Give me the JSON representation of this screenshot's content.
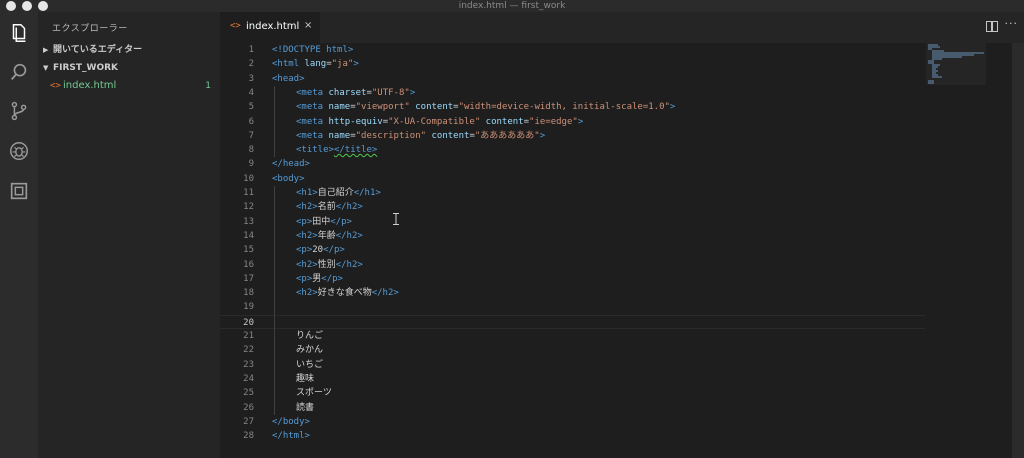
{
  "window": {
    "title": "index.html — first_work"
  },
  "activity_bar": {
    "icons": [
      "files-icon",
      "search-icon",
      "source-control-icon",
      "debug-icon",
      "extensions-icon"
    ]
  },
  "sidebar": {
    "title": "エクスプローラー",
    "open_editors_label": "開いているエディター",
    "project_label": "FIRST_WORK",
    "file": {
      "icon": "<>",
      "name": "index.html",
      "badge": "1"
    }
  },
  "tab": {
    "icon": "<>",
    "label": "index.html",
    "close": "×"
  },
  "editor": {
    "line_numbers": [
      "1",
      "2",
      "3",
      "4",
      "5",
      "6",
      "7",
      "8",
      "9",
      "10",
      "11",
      "12",
      "13",
      "14",
      "15",
      "16",
      "17",
      "18",
      "19",
      "20",
      "21",
      "22",
      "23",
      "24",
      "25",
      "26",
      "27",
      "28"
    ],
    "lines": [
      {
        "indent": 0,
        "parts": [
          {
            "t": "tag",
            "v": "<!DOCTYPE html>"
          }
        ]
      },
      {
        "indent": 0,
        "parts": [
          {
            "t": "tag",
            "v": "<html "
          },
          {
            "t": "attr",
            "v": "lang"
          },
          {
            "t": "txt",
            "v": "="
          },
          {
            "t": "str",
            "v": "\"ja\""
          },
          {
            "t": "tag",
            "v": ">"
          }
        ]
      },
      {
        "indent": 0,
        "parts": [
          {
            "t": "tag",
            "v": "<head>"
          }
        ]
      },
      {
        "indent": 1,
        "parts": [
          {
            "t": "tag",
            "v": "<meta "
          },
          {
            "t": "attr",
            "v": "charset"
          },
          {
            "t": "txt",
            "v": "="
          },
          {
            "t": "str",
            "v": "\"UTF-8\""
          },
          {
            "t": "tag",
            "v": ">"
          }
        ]
      },
      {
        "indent": 1,
        "parts": [
          {
            "t": "tag",
            "v": "<meta "
          },
          {
            "t": "attr",
            "v": "name"
          },
          {
            "t": "txt",
            "v": "="
          },
          {
            "t": "str",
            "v": "\"viewport\""
          },
          {
            "t": "txt",
            "v": " "
          },
          {
            "t": "attr",
            "v": "content"
          },
          {
            "t": "txt",
            "v": "="
          },
          {
            "t": "str",
            "v": "\"width=device-width, initial-scale=1.0\""
          },
          {
            "t": "tag",
            "v": ">"
          }
        ]
      },
      {
        "indent": 1,
        "parts": [
          {
            "t": "tag",
            "v": "<meta "
          },
          {
            "t": "attr",
            "v": "http-equiv"
          },
          {
            "t": "txt",
            "v": "="
          },
          {
            "t": "str",
            "v": "\"X-UA-Compatible\""
          },
          {
            "t": "txt",
            "v": " "
          },
          {
            "t": "attr",
            "v": "content"
          },
          {
            "t": "txt",
            "v": "="
          },
          {
            "t": "str",
            "v": "\"ie=edge\""
          },
          {
            "t": "tag",
            "v": ">"
          }
        ]
      },
      {
        "indent": 1,
        "parts": [
          {
            "t": "tag",
            "v": "<meta "
          },
          {
            "t": "attr",
            "v": "name"
          },
          {
            "t": "txt",
            "v": "="
          },
          {
            "t": "str",
            "v": "\"description\""
          },
          {
            "t": "txt",
            "v": " "
          },
          {
            "t": "attr",
            "v": "content"
          },
          {
            "t": "txt",
            "v": "="
          },
          {
            "t": "str",
            "v": "\"ああああああ\""
          },
          {
            "t": "tag",
            "v": ">"
          }
        ]
      },
      {
        "indent": 1,
        "parts": [
          {
            "t": "tag",
            "v": "<title>"
          },
          {
            "t": "tag squiggle",
            "v": "</title>"
          }
        ]
      },
      {
        "indent": 0,
        "parts": [
          {
            "t": "tag",
            "v": "</head>"
          }
        ]
      },
      {
        "indent": 0,
        "parts": [
          {
            "t": "tag",
            "v": "<body>"
          }
        ]
      },
      {
        "indent": 1,
        "parts": [
          {
            "t": "tag",
            "v": "<h1>"
          },
          {
            "t": "txt",
            "v": "自己紹介"
          },
          {
            "t": "tag",
            "v": "</h1>"
          }
        ]
      },
      {
        "indent": 1,
        "parts": [
          {
            "t": "tag",
            "v": "<h2>"
          },
          {
            "t": "txt",
            "v": "名前"
          },
          {
            "t": "tag",
            "v": "</h2>"
          }
        ]
      },
      {
        "indent": 1,
        "parts": [
          {
            "t": "tag",
            "v": "<p>"
          },
          {
            "t": "txt",
            "v": "田中"
          },
          {
            "t": "tag",
            "v": "</p>"
          }
        ]
      },
      {
        "indent": 1,
        "parts": [
          {
            "t": "tag",
            "v": "<h2>"
          },
          {
            "t": "txt",
            "v": "年齢"
          },
          {
            "t": "tag",
            "v": "</h2>"
          }
        ]
      },
      {
        "indent": 1,
        "parts": [
          {
            "t": "tag",
            "v": "<p>"
          },
          {
            "t": "txt",
            "v": "20"
          },
          {
            "t": "tag",
            "v": "</p>"
          }
        ]
      },
      {
        "indent": 1,
        "parts": [
          {
            "t": "tag",
            "v": "<h2>"
          },
          {
            "t": "txt",
            "v": "性別"
          },
          {
            "t": "tag",
            "v": "</h2>"
          }
        ]
      },
      {
        "indent": 1,
        "parts": [
          {
            "t": "tag",
            "v": "<p>"
          },
          {
            "t": "txt",
            "v": "男"
          },
          {
            "t": "tag",
            "v": "</p>"
          }
        ]
      },
      {
        "indent": 1,
        "parts": [
          {
            "t": "tag",
            "v": "<h2>"
          },
          {
            "t": "txt",
            "v": "好きな食べ物"
          },
          {
            "t": "tag",
            "v": "</h2>"
          }
        ]
      },
      {
        "indent": 1,
        "parts": []
      },
      {
        "indent": 1,
        "parts": []
      },
      {
        "indent": 1,
        "parts": [
          {
            "t": "txt",
            "v": "りんご"
          }
        ]
      },
      {
        "indent": 1,
        "parts": [
          {
            "t": "txt",
            "v": "みかん"
          }
        ]
      },
      {
        "indent": 1,
        "parts": [
          {
            "t": "txt",
            "v": "いちご"
          }
        ]
      },
      {
        "indent": 1,
        "parts": [
          {
            "t": "txt",
            "v": "趣味"
          }
        ]
      },
      {
        "indent": 1,
        "parts": [
          {
            "t": "txt",
            "v": "スポーツ"
          }
        ]
      },
      {
        "indent": 1,
        "parts": [
          {
            "t": "txt",
            "v": "読書"
          }
        ]
      },
      {
        "indent": 0,
        "parts": [
          {
            "t": "tag",
            "v": "</body>"
          }
        ]
      },
      {
        "indent": 0,
        "parts": [
          {
            "t": "tag",
            "v": "</html>"
          }
        ]
      }
    ],
    "current_line": "20"
  },
  "colors": {
    "tag": "#569cd6",
    "attribute": "#9cdcfe",
    "string": "#ce9178",
    "file_modified": "#73c991",
    "html_icon": "#e37933"
  }
}
